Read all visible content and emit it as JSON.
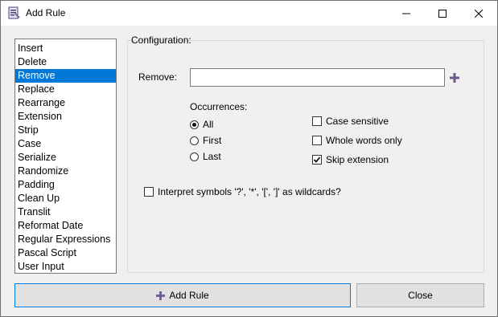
{
  "window": {
    "title": "Add Rule"
  },
  "rules": [
    {
      "label": "Insert"
    },
    {
      "label": "Delete"
    },
    {
      "label": "Remove",
      "selected": true
    },
    {
      "label": "Replace"
    },
    {
      "label": "Rearrange"
    },
    {
      "label": "Extension"
    },
    {
      "label": "Strip"
    },
    {
      "label": "Case"
    },
    {
      "label": "Serialize"
    },
    {
      "label": "Randomize"
    },
    {
      "label": "Padding"
    },
    {
      "label": "Clean Up"
    },
    {
      "label": "Translit"
    },
    {
      "label": "Reformat Date"
    },
    {
      "label": "Regular Expressions"
    },
    {
      "label": "Pascal Script"
    },
    {
      "label": "User Input"
    }
  ],
  "config": {
    "title": "Configuration:",
    "remove_label": "Remove:",
    "remove_value": "",
    "occurrences_label": "Occurrences:",
    "occurrences": {
      "all": "All",
      "first": "First",
      "last": "Last",
      "selected": "All"
    },
    "options": {
      "case_sensitive": {
        "label": "Case sensitive",
        "checked": false
      },
      "whole_words": {
        "label": "Whole words only",
        "checked": false
      },
      "skip_extension": {
        "label": "Skip extension",
        "checked": true
      }
    },
    "wildcards": {
      "label": "Interpret symbols '?', '*', '[', ']' as wildcards?",
      "checked": false
    }
  },
  "buttons": {
    "add_rule": "Add Rule",
    "close": "Close"
  },
  "colors": {
    "selection": "#0078d7",
    "plus_icon": "#6b5a8e"
  }
}
